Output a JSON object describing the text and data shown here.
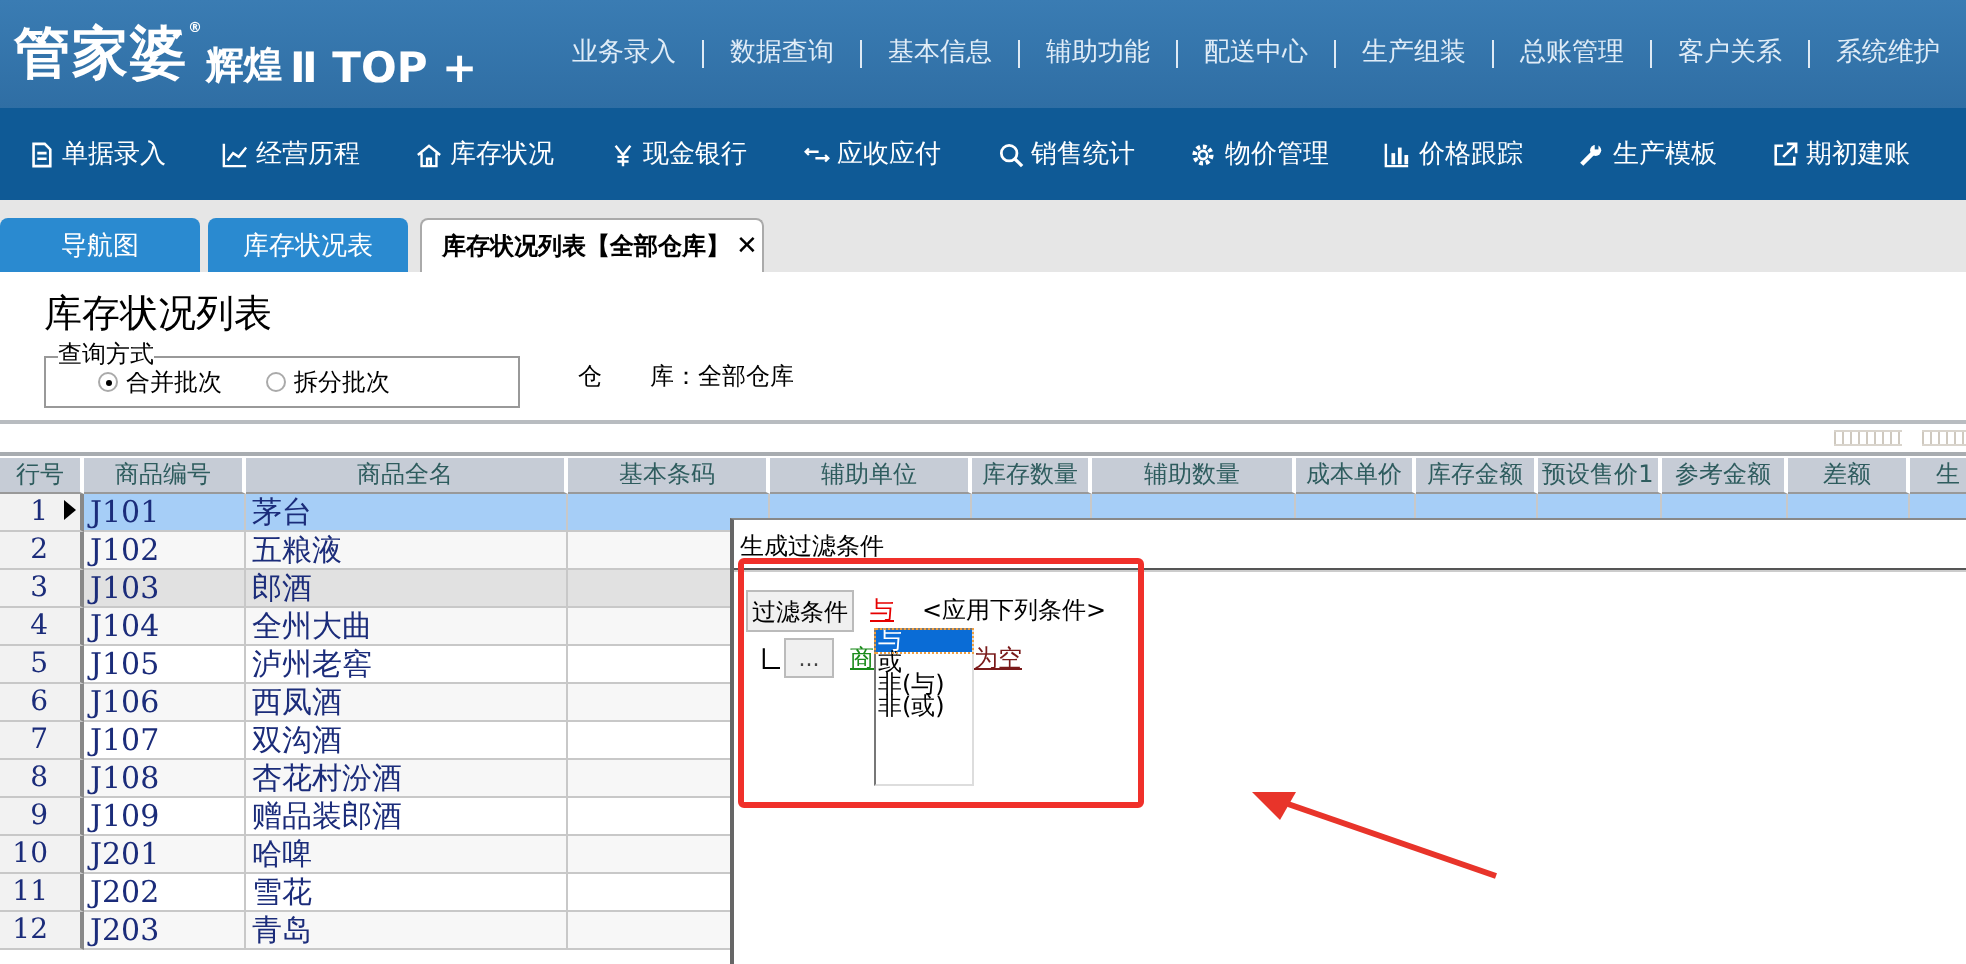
{
  "logo": {
    "brand": "管家婆",
    "mark": "®",
    "edition": "辉煌",
    "version": "Ⅱ TOP +"
  },
  "top_menu": [
    "业务录入",
    "数据查询",
    "基本信息",
    "辅助功能",
    "配送中心",
    "生产组装",
    "总账管理",
    "客户关系",
    "系统维护"
  ],
  "nav": [
    {
      "label": "单据录入"
    },
    {
      "label": "经营历程"
    },
    {
      "label": "库存状况"
    },
    {
      "label": "现金银行"
    },
    {
      "label": "应收应付"
    },
    {
      "label": "销售统计"
    },
    {
      "label": "物价管理"
    },
    {
      "label": "价格跟踪"
    },
    {
      "label": "生产模板"
    },
    {
      "label": "期初建账"
    }
  ],
  "tabs": [
    {
      "label": "导航图",
      "selected": false
    },
    {
      "label": "库存状况表",
      "selected": false
    },
    {
      "label": "库存状况列表【全部仓库】",
      "selected": true,
      "close": "✕"
    }
  ],
  "page_title": "库存状况列表",
  "query": {
    "legend": "查询方式",
    "options": [
      {
        "label": "合并批次",
        "selected": true
      },
      {
        "label": "拆分批次",
        "selected": false
      }
    ]
  },
  "warehouse": {
    "label_start": "仓",
    "label_end": "库：",
    "value": "全部仓库"
  },
  "table": {
    "columns": [
      "行号",
      "商品编号",
      "商品全名",
      "基本条码",
      "辅助单位",
      "库存数量",
      "辅助数量",
      "成本单价",
      "库存金额",
      "预设售价1",
      "参考金额",
      "差额",
      "生"
    ],
    "rows": [
      {
        "n": "1",
        "code": "J101",
        "name": "茅台",
        "selected": true,
        "shaded": false
      },
      {
        "n": "2",
        "code": "J102",
        "name": "五粮液",
        "selected": false,
        "shaded": false
      },
      {
        "n": "3",
        "code": "J103",
        "name": "郎酒",
        "selected": false,
        "shaded": true
      },
      {
        "n": "4",
        "code": "J104",
        "name": "全州大曲",
        "selected": false,
        "shaded": false
      },
      {
        "n": "5",
        "code": "J105",
        "name": "泸州老窖",
        "selected": false,
        "shaded": false
      },
      {
        "n": "6",
        "code": "J106",
        "name": "西凤酒",
        "selected": false,
        "shaded": false
      },
      {
        "n": "7",
        "code": "J107",
        "name": "双沟酒",
        "selected": false,
        "shaded": false
      },
      {
        "n": "8",
        "code": "J108",
        "name": "杏花村汾酒",
        "selected": false,
        "shaded": false
      },
      {
        "n": "9",
        "code": "J109",
        "name": "赠品装郎酒",
        "selected": false,
        "shaded": false
      },
      {
        "n": "10",
        "code": "J201",
        "name": "哈啤",
        "selected": false,
        "shaded": false
      },
      {
        "n": "11",
        "code": "J202",
        "name": "雪花",
        "selected": false,
        "shaded": false
      },
      {
        "n": "12",
        "code": "J203",
        "name": "青岛",
        "selected": false,
        "shaded": false
      }
    ]
  },
  "dialog": {
    "title": "生成过滤条件",
    "filter_button": "过滤条件",
    "operator": "与",
    "hint": "<应用下列条件>",
    "more_button": "...",
    "field": "商",
    "condition": "为空",
    "operator_options": [
      {
        "label": "与",
        "selected": true
      },
      {
        "label": "或",
        "selected": false
      },
      {
        "label": "非(与)",
        "selected": false
      },
      {
        "label": "非(或)",
        "selected": false
      }
    ]
  }
}
